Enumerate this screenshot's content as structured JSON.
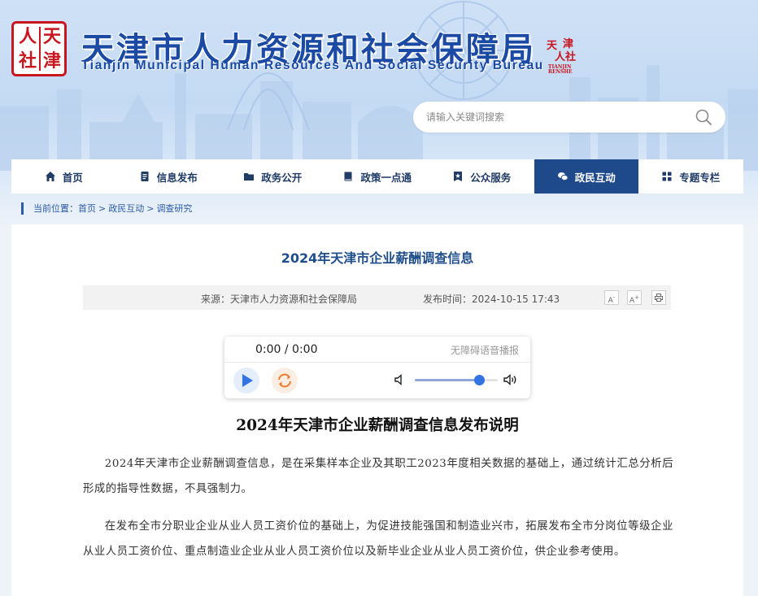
{
  "header": {
    "seal_chars": [
      "人",
      "天",
      "社",
      "津"
    ],
    "title": "天津市人力资源和社会保障局",
    "subtitle": "Tianjin Municipal Human Resources And Social Security Bureau",
    "mini_seal_chars": [
      "天",
      "津",
      "人社"
    ],
    "mini_seal_caption": "TIANJIN RENSHE"
  },
  "search": {
    "placeholder": "请输入关键词搜索",
    "icon": "search-icon"
  },
  "nav": {
    "items": [
      {
        "label": "首页",
        "icon": "home-icon"
      },
      {
        "label": "信息发布",
        "icon": "document-icon"
      },
      {
        "label": "政务公开",
        "icon": "folder-icon"
      },
      {
        "label": "政策一点通",
        "icon": "book-icon"
      },
      {
        "label": "公众服务",
        "icon": "star-badge-icon"
      },
      {
        "label": "政民互动",
        "icon": "chat-icon",
        "active": true
      },
      {
        "label": "专题专栏",
        "icon": "grid-icon"
      }
    ]
  },
  "breadcrumb": {
    "prefix": "当前位置：",
    "items": [
      "首页",
      "政民互动",
      "调查研究"
    ],
    "separator": ">"
  },
  "article": {
    "page_title": "2024年天津市企业薪酬调查信息",
    "source_label": "来源：",
    "source": "天津市人力资源和社会保障局",
    "date_label": "发布时间：",
    "date": "2024-10-15 17:43",
    "font_smaller": "A",
    "font_larger": "A",
    "title": "2024年天津市企业薪酬调查信息发布说明",
    "paragraphs": [
      "2024年天津市企业薪酬调查信息，是在采集样本企业及其职工2023年度相关数据的基础上，通过统计汇总分析后形成的指导性数据，不具强制力。",
      "在发布全市分职业企业从业人员工资价位的基础上，为促进技能强国和制造业兴市，拓展发布全市分岗位等级企业从业人员工资价位、重点制造业企业从业人员工资价位以及新毕业企业从业人员工资价位，供企业参考使用。"
    ]
  },
  "player": {
    "time": "0:00 / 0:00",
    "label": "无障碍语音播报",
    "volume": 0.78
  },
  "colors": {
    "brand_blue": "#1b4aa4",
    "nav_active": "#1e4a8c",
    "seal_red": "#c9151e",
    "title_blue": "#1f4e8c"
  }
}
